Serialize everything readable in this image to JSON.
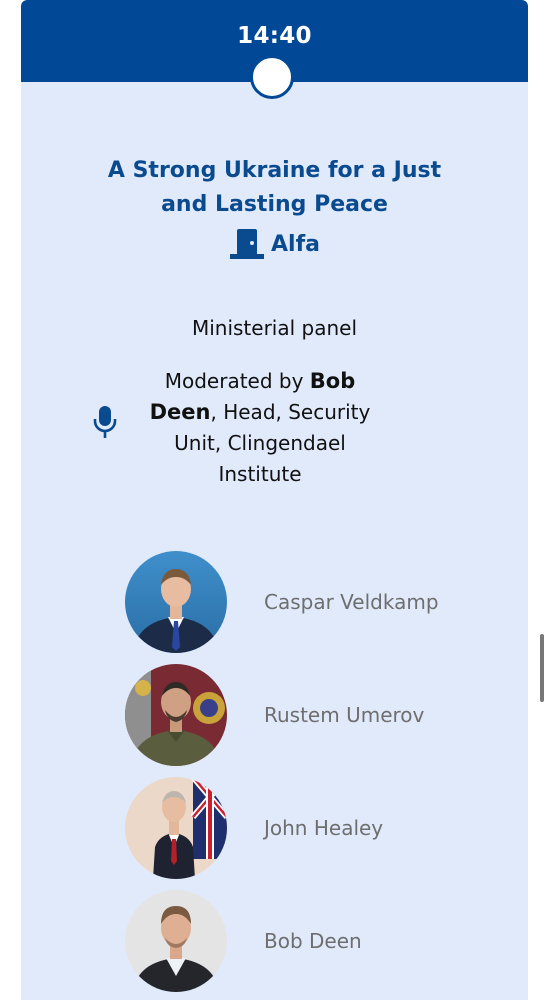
{
  "header": {
    "time": "14:40"
  },
  "session": {
    "title": "A Strong Ukraine for a Just and Lasting Peace",
    "room": "Alfa",
    "type": "Ministerial panel",
    "moderation": {
      "prefix": "Moderated by",
      "name": "Bob Deen",
      "role": ", Head, Security Unit, Clingendael Institute"
    }
  },
  "speakers": [
    {
      "name": "Caspar Veldkamp"
    },
    {
      "name": "Rustem Umerov"
    },
    {
      "name": "John Healey"
    },
    {
      "name": "Bob Deen"
    }
  ],
  "icons": {
    "room": "door-icon",
    "moderator": "microphone-icon"
  },
  "colors": {
    "brand": "#014996",
    "card_background": "#e1eafb",
    "title": "#0a4a8f",
    "speaker_name": "#6e6e6e"
  }
}
